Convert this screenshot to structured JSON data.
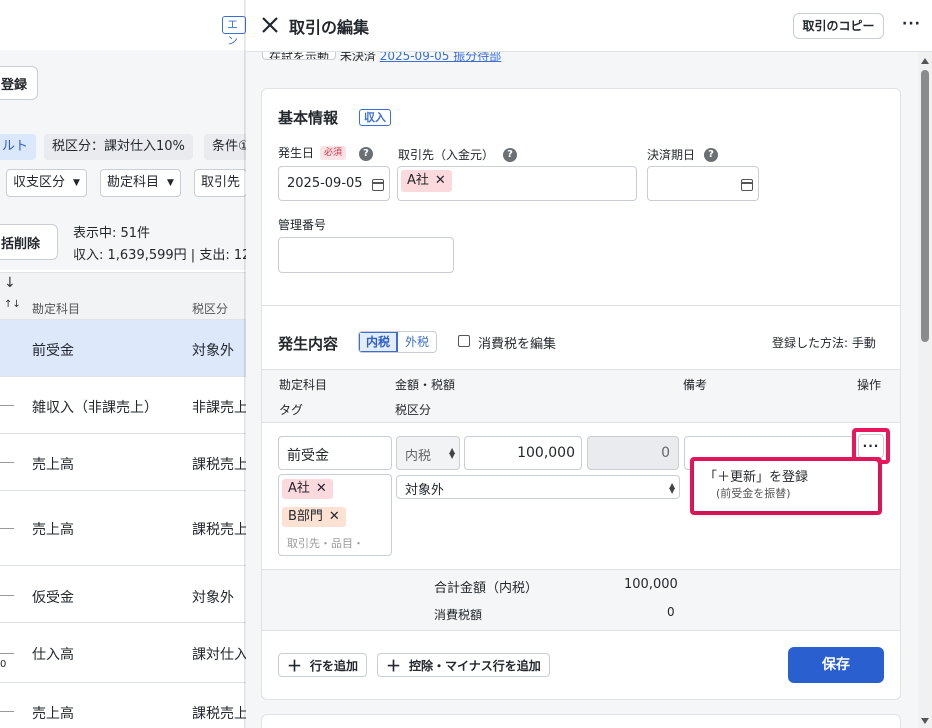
{
  "background": {
    "top_tag": "エン",
    "register_btn": "登録",
    "chips": [
      "ルト",
      "税区分：課対仕入10%",
      "条件①"
    ],
    "dropdowns": [
      "収支区分",
      "勘定科目",
      "取引先"
    ],
    "bulk_delete": "括削除",
    "count_text": "表示中: 51件",
    "summary_text": "収入: 1,639,599円 | 支出: 12",
    "sort_arrow": "↓",
    "sort_both": "↑↓",
    "col_account": "勘定科目",
    "col_tax": "税区分",
    "rows": [
      {
        "account": "前受金",
        "tax": "対象外",
        "selected": true
      },
      {
        "account": "雑収入（非課売上）",
        "tax": "非課売上"
      },
      {
        "account": "売上高",
        "tax": "課税売上"
      },
      {
        "account": "売上高",
        "tax": "課税売上"
      },
      {
        "account": "仮受金",
        "tax": "対象外"
      },
      {
        "account": "仕入高",
        "tax": "課対仕入"
      },
      {
        "account": "売上高",
        "tax": "課税売上"
      }
    ],
    "left_digit": "0"
  },
  "drawer": {
    "title": "取引の編集",
    "copy_button": "取引のコピー",
    "more": "···",
    "peek_button": "在試を示動",
    "peek_text": "未決済",
    "peek_link": "2025-09-05 振分待部",
    "basic": {
      "title": "基本情報",
      "type_badge": "収入",
      "date_label": "発生日",
      "required": "必須",
      "date_value": "2025-09-05",
      "partner_label": "取引先（入金元）",
      "partner_chip": "A社",
      "due_label": "決済期日",
      "mgmt_label": "管理番号",
      "help": "?"
    },
    "detail": {
      "title": "発生内容",
      "tax_incl": "内税",
      "tax_excl": "外税",
      "edit_tax_label": "消費税を編集",
      "method": "登録した方法: 手動",
      "col_account": "勘定科目",
      "col_amount": "金額・税額",
      "col_note": "備考",
      "col_action": "操作",
      "col_tag": "タグ",
      "col_taxcat": "税区分",
      "row": {
        "account": "前受金",
        "tax_mode": "内税",
        "amount": "100,000",
        "tax_amount": "0",
        "tax_category": "対象外",
        "tags": [
          "A社",
          "B部門"
        ],
        "tag_placeholder": "取引先・品目・"
      },
      "menu_more": "···",
      "popup_title": "「＋更新」を登録",
      "popup_sub": "(前受金を振替)",
      "total_label": "合計金額（内税）",
      "total_value": "100,000",
      "consumption_label": "消費税額",
      "consumption_value": "0",
      "add_row": "行を追加",
      "add_deduct_row": "控除・マイナス行を追加",
      "save": "保存"
    }
  },
  "colors": {
    "accent": "#2a5fcf",
    "highlight": "#e8175d",
    "selected_row": "#dde8fb",
    "tag_pink": "#fbd9dd",
    "tag_orange": "#fde2d4"
  }
}
